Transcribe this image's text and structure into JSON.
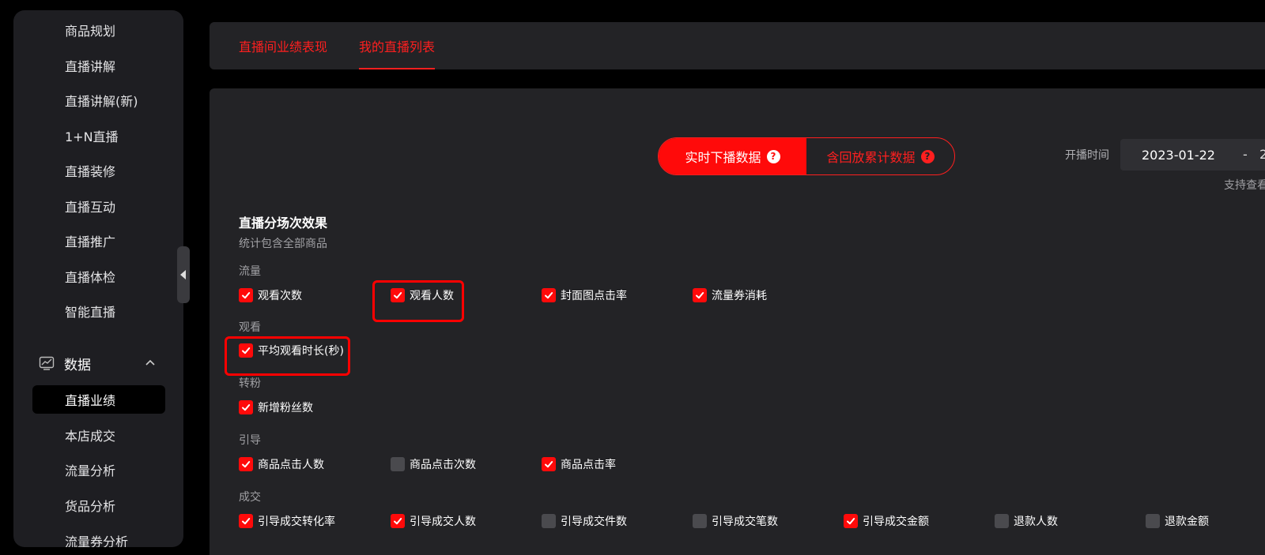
{
  "sidebar": {
    "items": [
      "商品规划",
      "直播讲解",
      "直播讲解(新)",
      "1+N直播",
      "直播装修",
      "直播互动",
      "直播推广",
      "直播体检",
      "智能直播"
    ],
    "group_label": "数据",
    "group_items": [
      "直播业绩",
      "本店成交",
      "流量分析",
      "货品分析",
      "流量券分析"
    ]
  },
  "tabs": [
    "直播间业绩表现",
    "我的直播列表"
  ],
  "segment": {
    "realtime": "实时下播数据",
    "cumulative": "含回放累计数据",
    "help_glyph": "?"
  },
  "date": {
    "label": "开播时间",
    "start": "2023-01-22",
    "separator": "-",
    "end_partial": "2",
    "hint": "支持查看"
  },
  "section": {
    "title": "直播分场次效果",
    "subtitle": "统计包含全部商品"
  },
  "groups": {
    "traffic": "流量",
    "watch": "观看",
    "fans": "转粉",
    "guide": "引导",
    "deal": "成交"
  },
  "metrics": {
    "view_count": {
      "label": "观看次数",
      "checked": true
    },
    "viewer_count": {
      "label": "观看人数",
      "checked": true
    },
    "cover_ctr": {
      "label": "封面图点击率",
      "checked": true
    },
    "coupon_cost": {
      "label": "流量券消耗",
      "checked": true
    },
    "avg_watch": {
      "label": "平均观看时长(秒)",
      "checked": true
    },
    "new_fans": {
      "label": "新增粉丝数",
      "checked": true
    },
    "prod_click_users": {
      "label": "商品点击人数",
      "checked": true
    },
    "prod_click_times": {
      "label": "商品点击次数",
      "checked": false
    },
    "prod_ctr": {
      "label": "商品点击率",
      "checked": true
    },
    "deal_cvr": {
      "label": "引导成交转化率",
      "checked": true
    },
    "deal_users": {
      "label": "引导成交人数",
      "checked": true
    },
    "deal_items": {
      "label": "引导成交件数",
      "checked": false
    },
    "deal_orders": {
      "label": "引导成交笔数",
      "checked": false
    },
    "deal_amount": {
      "label": "引导成交金额",
      "checked": true
    },
    "refund_users": {
      "label": "退款人数",
      "checked": false
    },
    "refund_amount": {
      "label": "退款金额",
      "checked": false
    }
  },
  "colors": {
    "accent": "#ff0a0a",
    "sidebar_bg": "#1e1e22",
    "panel_bg": "#232326"
  }
}
